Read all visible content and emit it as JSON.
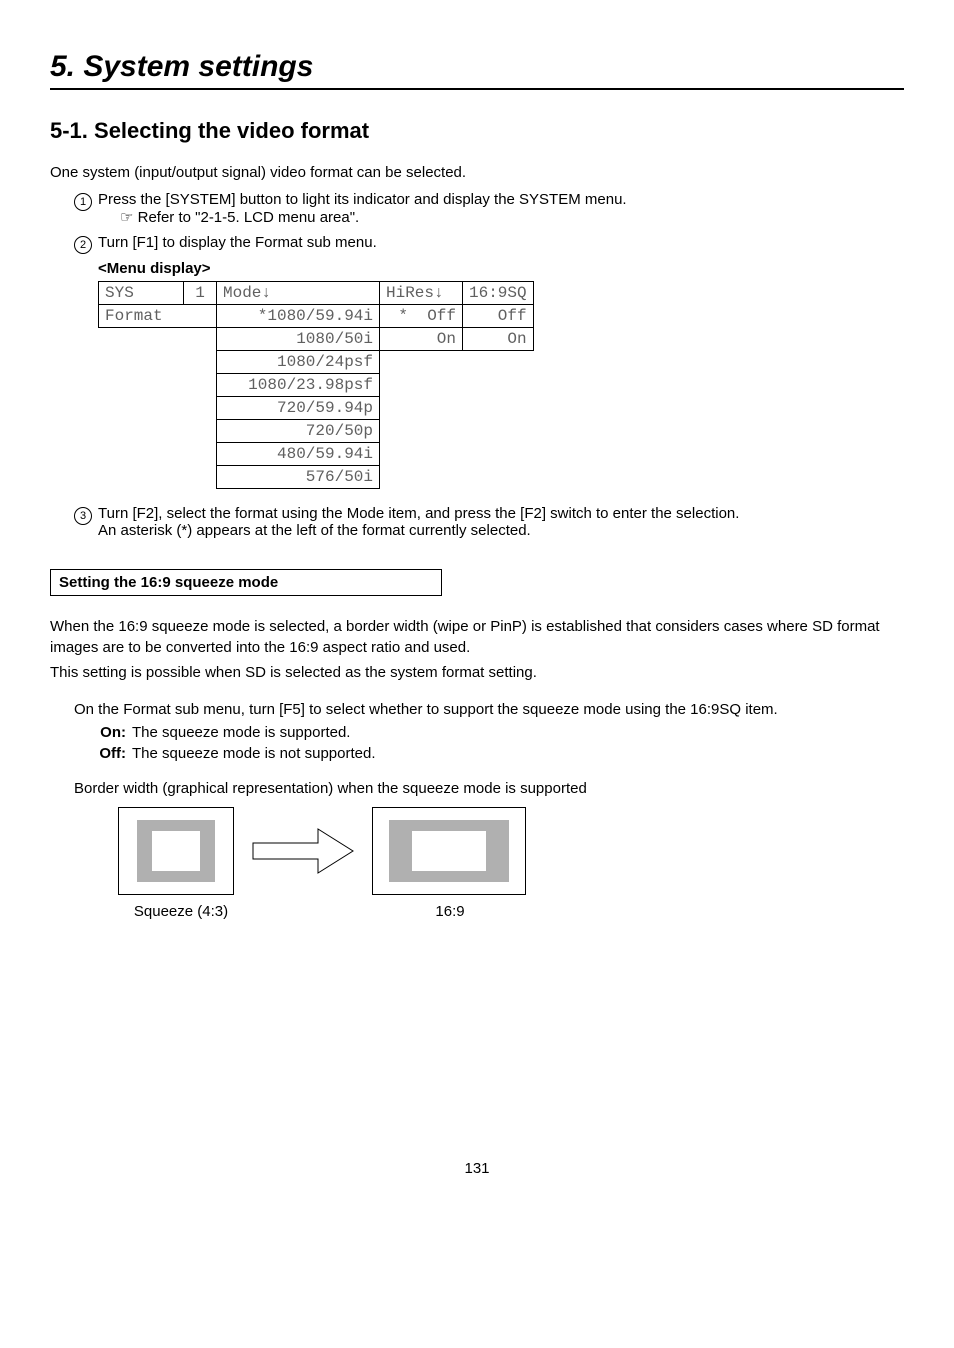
{
  "chapter": {
    "title": "5. System settings"
  },
  "section": {
    "title": "5-1. Selecting the video format"
  },
  "intro": "One system (input/output signal) video format can be selected.",
  "step1": {
    "text": "Press the [SYSTEM] button to light its indicator and display the SYSTEM menu.",
    "ref": "Refer to \"2-1-5. LCD menu area\"."
  },
  "step2": {
    "text": "Turn [F1] to display the Format sub menu."
  },
  "menu": {
    "label": "<Menu display>",
    "header": {
      "sys": "SYS",
      "page": "1",
      "mode_h": "Mode↓",
      "hires_h": "HiRes↓",
      "sq_h": "16:9SQ"
    },
    "row": {
      "format": "Format",
      "mode": "1080/59.94i",
      "hires": "Off",
      "sq": "Off"
    },
    "opts": {
      "m1": "1080/50i",
      "m2": "1080/24psf",
      "m3": "1080/23.98psf",
      "m4": "720/59.94p",
      "m5": "720/50p",
      "m6": "480/59.94i",
      "m7": "576/50i",
      "h1": "On",
      "s1": "On"
    },
    "asterisk": "*"
  },
  "step3": {
    "line1": "Turn [F2], select the format using the Mode item, and press the [F2] switch to enter the selection.",
    "line2_a": "An asterisk (",
    "line2_b": ") appears at the left of the format currently selected."
  },
  "box": {
    "title": "Setting the 16:9 squeeze mode"
  },
  "squeeze": {
    "p1": "When the 16:9 squeeze mode is selected, a border width (wipe or PinP) is established that considers cases where SD format images are to be converted into the 16:9 aspect ratio and used.",
    "p2": "This setting is possible when SD is selected as the system format setting.",
    "instr": "On the Format sub menu, turn [F5] to select whether to support the squeeze mode using the 16:9SQ item.",
    "on_l": "On:",
    "on_t": "The squeeze mode is supported.",
    "off_l": "Off:",
    "off_t": "The squeeze mode is not supported.",
    "cap": "Border width (graphical representation) when the squeeze mode is supported",
    "lab43": "Squeeze (4:3)",
    "lab169": "16:9"
  },
  "pageNumber": "131"
}
